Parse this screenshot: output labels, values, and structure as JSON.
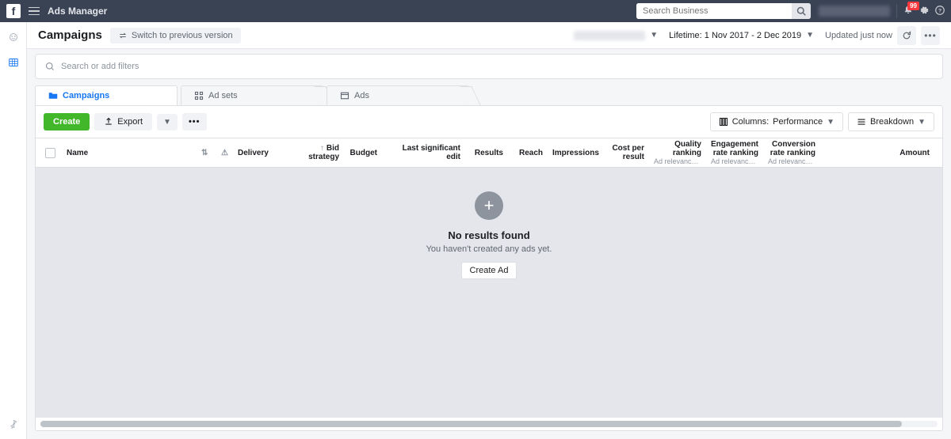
{
  "topbar": {
    "app_title": "Ads Manager",
    "search_placeholder": "Search Business",
    "notification_count": "99"
  },
  "titlebar": {
    "page_title": "Campaigns",
    "switch_label": "Switch to previous version",
    "date_range": "Lifetime: 1 Nov 2017 - 2 Dec 2019",
    "updated_label": "Updated just now"
  },
  "filterbar": {
    "placeholder": "Search or add filters"
  },
  "tabs": [
    {
      "label": "Campaigns"
    },
    {
      "label": "Ad sets"
    },
    {
      "label": "Ads"
    }
  ],
  "toolbar": {
    "create_label": "Create",
    "export_label": "Export",
    "columns_label": "Columns:",
    "columns_value": "Performance",
    "breakdown_label": "Breakdown"
  },
  "table": {
    "headers": {
      "name": "Name",
      "delivery": "Delivery",
      "bid_strategy": "Bid strategy",
      "budget": "Budget",
      "last_edit": "Last significant edit",
      "results": "Results",
      "reach": "Reach",
      "impressions": "Impressions",
      "cost_per_result": "Cost per result",
      "quality_ranking": "Quality ranking",
      "quality_ranking_sub": "Ad relevance dia...",
      "engagement_ranking": "Engagement rate ranking",
      "engagement_ranking_sub": "Ad relevance dia...",
      "conversion_ranking": "Conversion rate ranking",
      "conversion_ranking_sub": "Ad relevance dia...",
      "amount": "Amount"
    },
    "empty": {
      "title": "No results found",
      "subtitle": "You haven't created any ads yet.",
      "cta": "Create Ad"
    }
  }
}
